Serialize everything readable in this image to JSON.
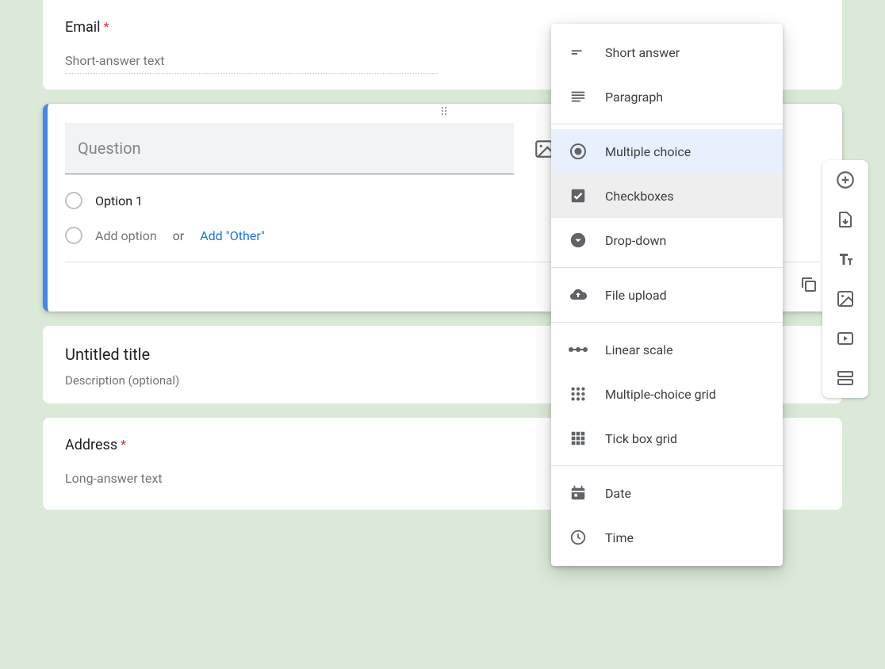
{
  "email_question": {
    "title": "Email",
    "required": true,
    "placeholder": "Short-answer text"
  },
  "active_question": {
    "title_placeholder": "Question",
    "option1": "Option 1",
    "add_option": "Add option",
    "or_text": "or",
    "add_other": "Add \"Other\""
  },
  "section": {
    "title": "Untitled title",
    "description": "Description (optional)"
  },
  "address_question": {
    "title": "Address",
    "required": true,
    "placeholder": "Long-answer text"
  },
  "qtype_menu": {
    "short_answer": "Short answer",
    "paragraph": "Paragraph",
    "multiple_choice": "Multiple choice",
    "checkboxes": "Checkboxes",
    "dropdown": "Drop-down",
    "file_upload": "File upload",
    "linear_scale": "Linear scale",
    "mc_grid": "Multiple-choice grid",
    "tick_grid": "Tick box grid",
    "date": "Date",
    "time": "Time",
    "selected": "multiple_choice",
    "hovered": "checkboxes"
  }
}
